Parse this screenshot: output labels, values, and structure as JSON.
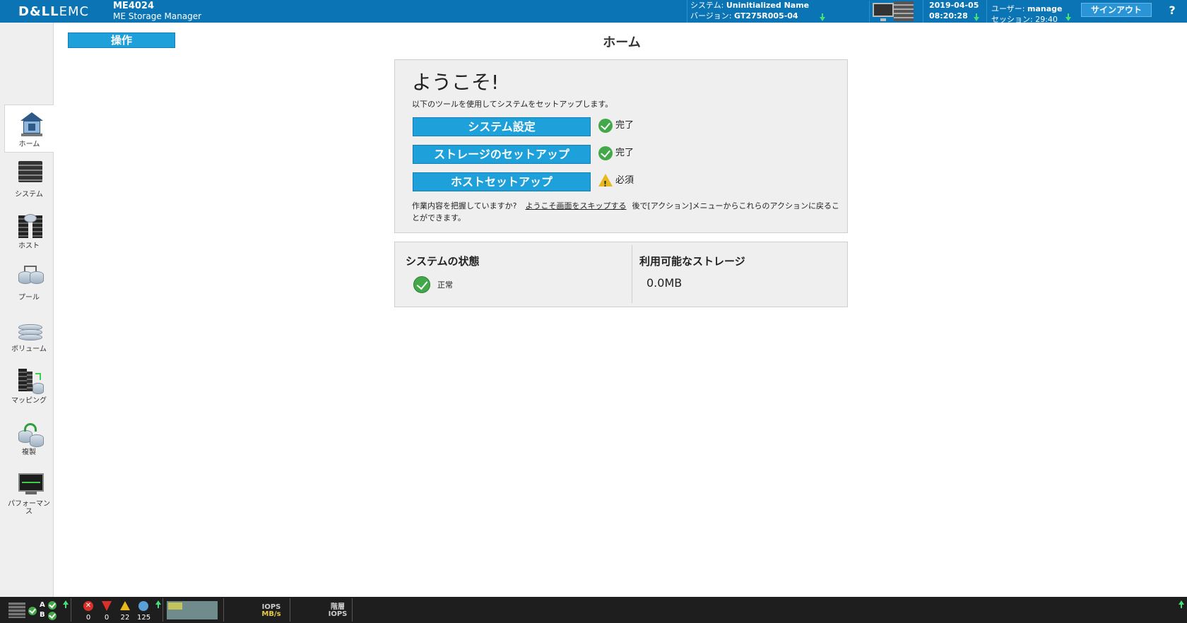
{
  "header": {
    "logo_main": "D&LL",
    "logo_sub": "EMC",
    "model": "ME4024",
    "app_name": "ME Storage Manager",
    "system_label": "システム: ",
    "system_name": "Uninitialized Name",
    "version_label": "バージョン: ",
    "version": "GT275R005-04",
    "date": "2019-04-05",
    "time": "08:20:28",
    "user_label": "ユーザー: ",
    "user": "manage",
    "session_label": "セッション: ",
    "session": "29:40",
    "signout_label": "サインアウト",
    "help_label": "?"
  },
  "nav": {
    "items": [
      {
        "label": "ホーム",
        "icon": "home-icon"
      },
      {
        "label": "システム",
        "icon": "system-icon"
      },
      {
        "label": "ホスト",
        "icon": "host-icon"
      },
      {
        "label": "プール",
        "icon": "pool-icon"
      },
      {
        "label": "ボリューム",
        "icon": "volume-icon"
      },
      {
        "label": "マッピング",
        "icon": "mapping-icon"
      },
      {
        "label": "複製",
        "icon": "replication-icon"
      },
      {
        "label": "パフォーマンス",
        "icon": "performance-icon"
      }
    ]
  },
  "main": {
    "action_label": "操作",
    "title": "ホーム",
    "welcome": {
      "heading": "ようこそ!",
      "subtitle": "以下のツールを使用してシステムをセットアップします。",
      "steps": [
        {
          "label": "システム設定",
          "status": "完了",
          "state": "ok"
        },
        {
          "label": "ストレージのセットアップ",
          "status": "完了",
          "state": "ok"
        },
        {
          "label": "ホストセットアップ",
          "status": "必須",
          "state": "warning"
        }
      ],
      "note_prefix": "作業内容を把握していますか?",
      "skip_link": "ようこそ画面をスキップする",
      "note_suffix": "後で[アクション]メニューからこれらのアクションに戻ることができます。"
    },
    "system_status": {
      "title": "システムの状態",
      "status": "正常"
    },
    "storage": {
      "title": "利用可能なストレージ",
      "value": "0.0MB"
    }
  },
  "footer": {
    "controller_a": "A",
    "controller_b": "B",
    "alerts": {
      "critical": "0",
      "error": "0",
      "warning": "22",
      "info": "125"
    },
    "metric1_top": "IOPS",
    "metric1_bottom": "MB/s",
    "metric2_top": "階層",
    "metric2_bottom": "IOPS"
  },
  "colors": {
    "header_bg": "#0b74b4",
    "button_bg": "#1ea0db",
    "ok": "#43a84a",
    "warning": "#e8b91c"
  }
}
